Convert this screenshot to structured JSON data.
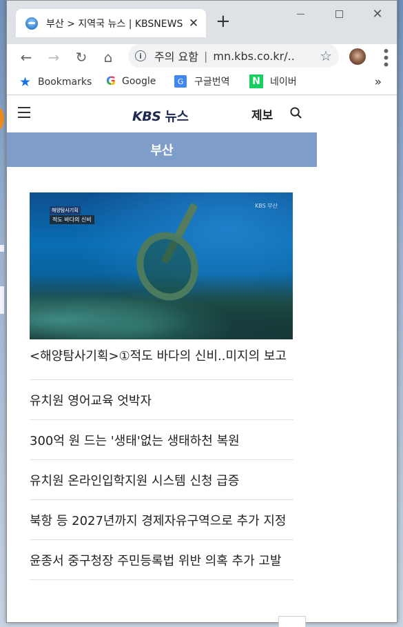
{
  "browser": {
    "tab": {
      "title": "부산 > 지역국 뉴스 | KBSNEWS"
    },
    "omnibox": {
      "security_label": "주의 요함",
      "separator": "|",
      "url": "mn.kbs.co.kr/..."
    },
    "bookmarks": [
      {
        "label": "Bookmarks",
        "icon": "star-icon"
      },
      {
        "label": "Google",
        "icon": "google-icon"
      },
      {
        "label": "구글번역",
        "icon": "google-translate-icon"
      },
      {
        "label": "네이버",
        "icon": "naver-icon"
      }
    ],
    "bookmarks_more": "»"
  },
  "site": {
    "logo": {
      "brand": "KBS",
      "suffix": " 뉴스"
    },
    "report_label": "제보",
    "region": "부산"
  },
  "hero": {
    "caption_top": "해양탐사기획",
    "caption_main": "적도 바다의 신비",
    "watermark": "KBS 부산",
    "headline": "<해양탐사기획>①적도 바다의 신비..미지의 보고"
  },
  "news_list": [
    "유치원 영어교육 엇박자",
    "300억 원 드는 '생태'없는 생태하천 복원",
    "유치원 온라인입학지원 시스템 신청 급증",
    "북항 등 2027년까지 경제자유구역으로 추가 지정",
    "윤종서 중구청장 주민등록법 위반 의혹 추가 고발"
  ]
}
